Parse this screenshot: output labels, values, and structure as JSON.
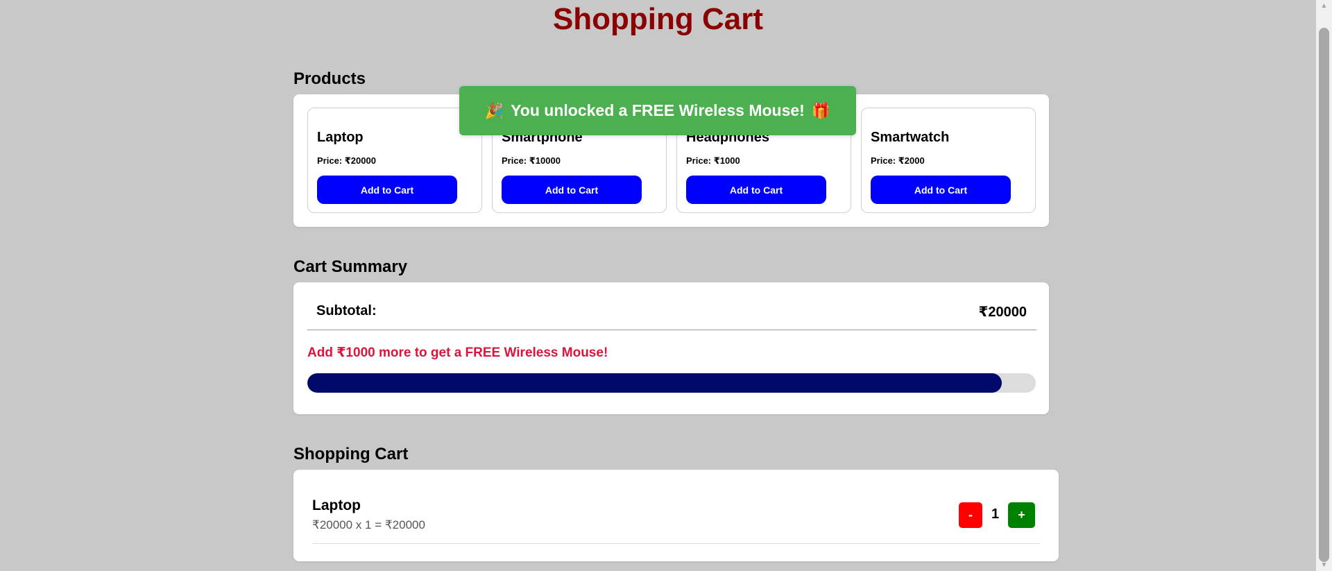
{
  "header": {
    "title": "Shopping Cart"
  },
  "products": {
    "heading": "Products",
    "items": [
      {
        "name": "Laptop",
        "price": "Price: ₹20000",
        "button": "Add to Cart"
      },
      {
        "name": "Smartphone",
        "price": "Price: ₹10000",
        "button": "Add to Cart"
      },
      {
        "name": "Headphones",
        "price": "Price: ₹1000",
        "button": "Add to Cart"
      },
      {
        "name": "Smartwatch",
        "price": "Price: ₹2000",
        "button": "Add to Cart"
      }
    ]
  },
  "toast": {
    "text": "You unlocked a FREE Wireless Mouse!",
    "left_emoji": "🎉",
    "right_emoji": "🎁"
  },
  "summary": {
    "heading": "Cart Summary",
    "subtotal_label": "Subtotal:",
    "subtotal_value": "₹20000",
    "promo": "Add ₹1000 more to get a FREE Wireless Mouse!",
    "progress_fraction": 0.953
  },
  "cart": {
    "heading": "Shopping Cart",
    "items": [
      {
        "name": "Laptop",
        "calc": "₹20000 x 1 = ₹20000",
        "qty": "1",
        "minus": "-",
        "plus": "+"
      }
    ]
  },
  "colors": {
    "background": "#c8c8c8",
    "title": "#8b0000",
    "add_button": "#0000ff",
    "toast": "#4caf50",
    "promo": "#dc143c",
    "progress": "#000a6b",
    "minus": "#ff0000",
    "plus": "#008000"
  }
}
